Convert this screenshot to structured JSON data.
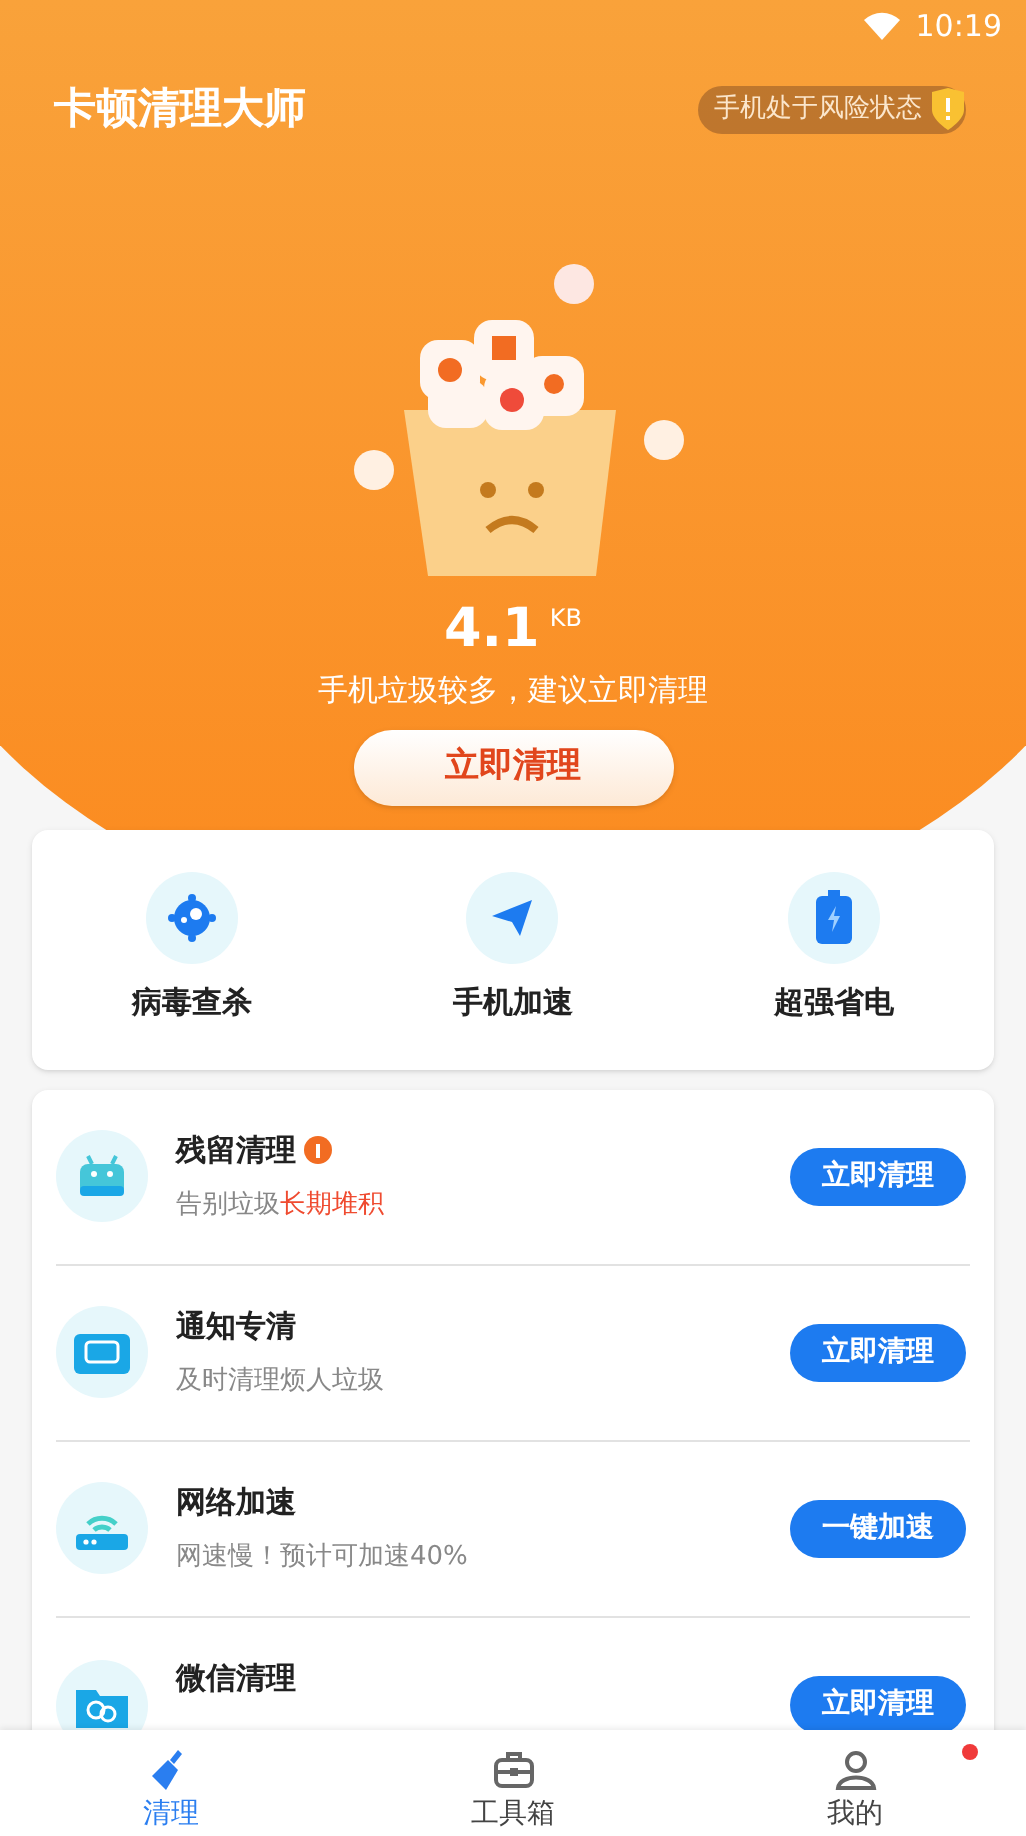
{
  "status_bar": {
    "time": "10:19"
  },
  "header": {
    "title": "卡顿清理大师",
    "risk_badge": "手机处于风险状态"
  },
  "junk": {
    "size": "4.1",
    "unit": "KB",
    "message": "手机垃圾较多，建议立即清理",
    "button": "立即清理"
  },
  "tools": [
    {
      "kind": "virus",
      "label": "病毒查杀"
    },
    {
      "kind": "speed",
      "label": "手机加速"
    },
    {
      "kind": "battery",
      "label": "超强省电"
    }
  ],
  "tasks": [
    {
      "kind": "android",
      "title": "残留清理",
      "alert": true,
      "subtitle": "告别垃圾",
      "subtitle_highlight": "长期堆积",
      "button": "立即清理"
    },
    {
      "kind": "notify",
      "title": "通知专清",
      "alert": false,
      "subtitle": "及时清理烦人垃圾",
      "button": "立即清理"
    },
    {
      "kind": "network",
      "title": "网络加速",
      "alert": false,
      "subtitle": "网速慢！预计可加速40%",
      "button": "一键加速"
    },
    {
      "kind": "wechat",
      "title": "微信清理",
      "alert": false,
      "button": "立即清理"
    }
  ],
  "tab_bar": [
    {
      "kind": "clean",
      "label": "清理",
      "selected": true,
      "badge": false
    },
    {
      "kind": "toolbox",
      "label": "工具箱",
      "selected": false,
      "badge": false
    },
    {
      "kind": "profile",
      "label": "我的",
      "selected": false,
      "badge": true
    }
  ]
}
